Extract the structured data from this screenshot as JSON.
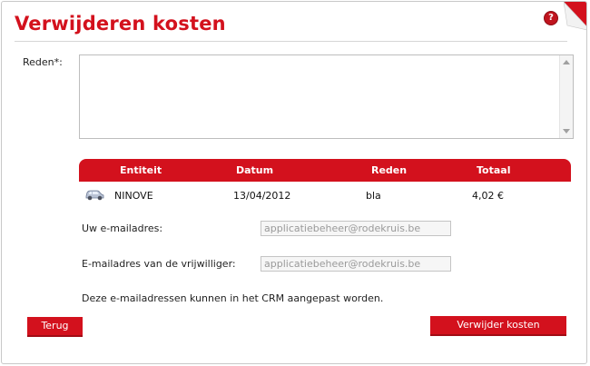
{
  "dialog": {
    "title": "Verwijderen kosten",
    "help_icon": "help-icon",
    "help_glyph": "?",
    "corner_icon": "page-curl-icon"
  },
  "form": {
    "reason_label": "Reden*:",
    "reason_value": "",
    "email_label": "Uw e-mailadres:",
    "email_value": "applicatiebeheer@rodekruis.be",
    "volunteer_email_label": "E-mailadres van de vrijwilliger:",
    "volunteer_email_value": "applicatiebeheer@rodekruis.be",
    "note": "Deze e-mailadressen kunnen in het CRM aangepast worden."
  },
  "table": {
    "headers": [
      "Entiteit",
      "Datum",
      "Reden",
      "Totaal"
    ],
    "rows": [
      {
        "icon": "car-icon",
        "entity": "NINOVE",
        "date": "13/04/2012",
        "reason": "bla",
        "total": "4,02 €"
      }
    ]
  },
  "buttons": {
    "back": "Terug",
    "delete": "Verwijder kosten"
  },
  "colors": {
    "accent": "#d3111d",
    "input_text": "#9a9a9a"
  }
}
